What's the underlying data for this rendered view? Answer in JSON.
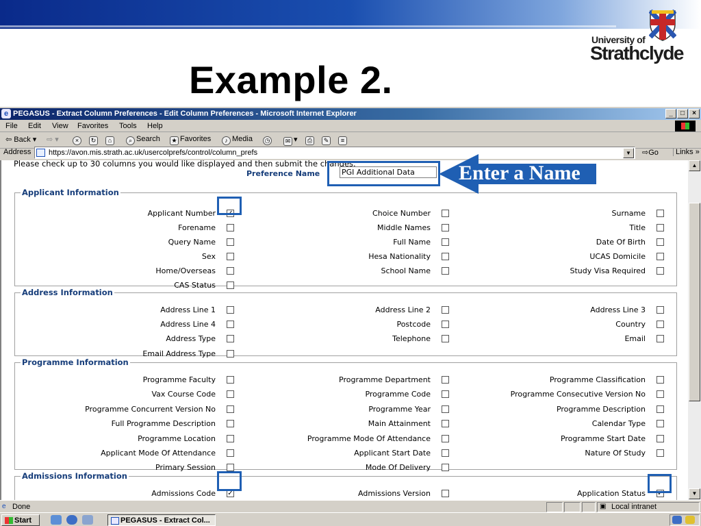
{
  "slide": {
    "title": "Example 2.",
    "logo": {
      "line1": "University of",
      "line2": "Strathclyde"
    }
  },
  "window": {
    "title": "PEGASUS - Extract Column Preferences - Edit Column Preferences - Microsoft Internet Explorer",
    "controls": {
      "minimize": "_",
      "maximize": "□",
      "close": "×"
    }
  },
  "menu": [
    "File",
    "Edit",
    "View",
    "Favorites",
    "Tools",
    "Help"
  ],
  "toolbar": {
    "back": "Back",
    "search": "Search",
    "favorites": "Favorites",
    "media": "Media"
  },
  "address": {
    "label": "Address",
    "url": "https://avon.mis.strath.ac.uk/usercolprefs/control/column_prefs",
    "go": "Go",
    "links": "Links"
  },
  "form": {
    "intro": "Please check up to 30 columns you would like displayed and then submit the changes.",
    "pref_label": "Preference Name",
    "pref_value": "PGI Additional Data"
  },
  "sections": [
    {
      "legend": "Applicant Information",
      "rows": [
        [
          {
            "label": "Applicant Number",
            "checked": true
          },
          {
            "label": "Choice Number",
            "checked": false
          },
          {
            "label": "Surname",
            "checked": false
          }
        ],
        [
          {
            "label": "Forename",
            "checked": false
          },
          {
            "label": "Middle Names",
            "checked": false
          },
          {
            "label": "Title",
            "checked": false
          }
        ],
        [
          {
            "label": "Query Name",
            "checked": false
          },
          {
            "label": "Full Name",
            "checked": false
          },
          {
            "label": "Date Of Birth",
            "checked": false
          }
        ],
        [
          {
            "label": "Sex",
            "checked": false
          },
          {
            "label": "Hesa Nationality",
            "checked": false
          },
          {
            "label": "UCAS Domicile",
            "checked": false
          }
        ],
        [
          {
            "label": "Home/Overseas",
            "checked": false
          },
          {
            "label": "School Name",
            "checked": false
          },
          {
            "label": "Study Visa Required",
            "checked": false
          }
        ],
        [
          {
            "label": "CAS Status",
            "checked": false
          }
        ]
      ]
    },
    {
      "legend": "Address Information",
      "rows": [
        [
          {
            "label": "Address Line 1",
            "checked": false
          },
          {
            "label": "Address Line 2",
            "checked": false
          },
          {
            "label": "Address Line 3",
            "checked": false
          }
        ],
        [
          {
            "label": "Address Line 4",
            "checked": false
          },
          {
            "label": "Postcode",
            "checked": false
          },
          {
            "label": "Country",
            "checked": false
          }
        ],
        [
          {
            "label": "Address Type",
            "checked": false
          },
          {
            "label": "Telephone",
            "checked": false
          },
          {
            "label": "Email",
            "checked": false
          }
        ],
        [
          {
            "label": "Email Address Type",
            "checked": false
          }
        ]
      ]
    },
    {
      "legend": "Programme Information",
      "rows": [
        [
          {
            "label": "Programme Faculty",
            "checked": false
          },
          {
            "label": "Programme Department",
            "checked": false
          },
          {
            "label": "Programme Classification",
            "checked": false
          }
        ],
        [
          {
            "label": "Vax Course Code",
            "checked": false
          },
          {
            "label": "Programme Code",
            "checked": false
          },
          {
            "label": "Programme Consecutive Version No",
            "checked": false
          }
        ],
        [
          {
            "label": "Programme Concurrent Version No",
            "checked": false
          },
          {
            "label": "Programme Year",
            "checked": false
          },
          {
            "label": "Programme Description",
            "checked": false
          }
        ],
        [
          {
            "label": "Full Programme Description",
            "checked": false
          },
          {
            "label": "Main Attainment",
            "checked": false
          },
          {
            "label": "Calendar Type",
            "checked": false
          }
        ],
        [
          {
            "label": "Programme Location",
            "checked": false
          },
          {
            "label": "Programme Mode Of Attendance",
            "checked": false
          },
          {
            "label": "Programme Start Date",
            "checked": false
          }
        ],
        [
          {
            "label": "Applicant Mode Of Attendance",
            "checked": false
          },
          {
            "label": "Applicant Start Date",
            "checked": false
          },
          {
            "label": "Nature Of Study",
            "checked": false
          }
        ],
        [
          {
            "label": "Primary Session",
            "checked": false
          },
          {
            "label": "Mode Of Delivery",
            "checked": false
          }
        ]
      ]
    },
    {
      "legend": "Admissions Information",
      "rows": [
        [
          {
            "label": "Admissions Code",
            "checked": true
          },
          {
            "label": "Admissions Version",
            "checked": false
          },
          {
            "label": "Application Status",
            "checked": true
          }
        ]
      ]
    }
  ],
  "callout": {
    "text": "Enter a Name",
    "color": "#1f5fb3"
  },
  "status": {
    "text": "Done",
    "zone": "Local intranet"
  },
  "taskbar": {
    "start": "Start",
    "task": "PEGASUS - Extract Col..."
  }
}
